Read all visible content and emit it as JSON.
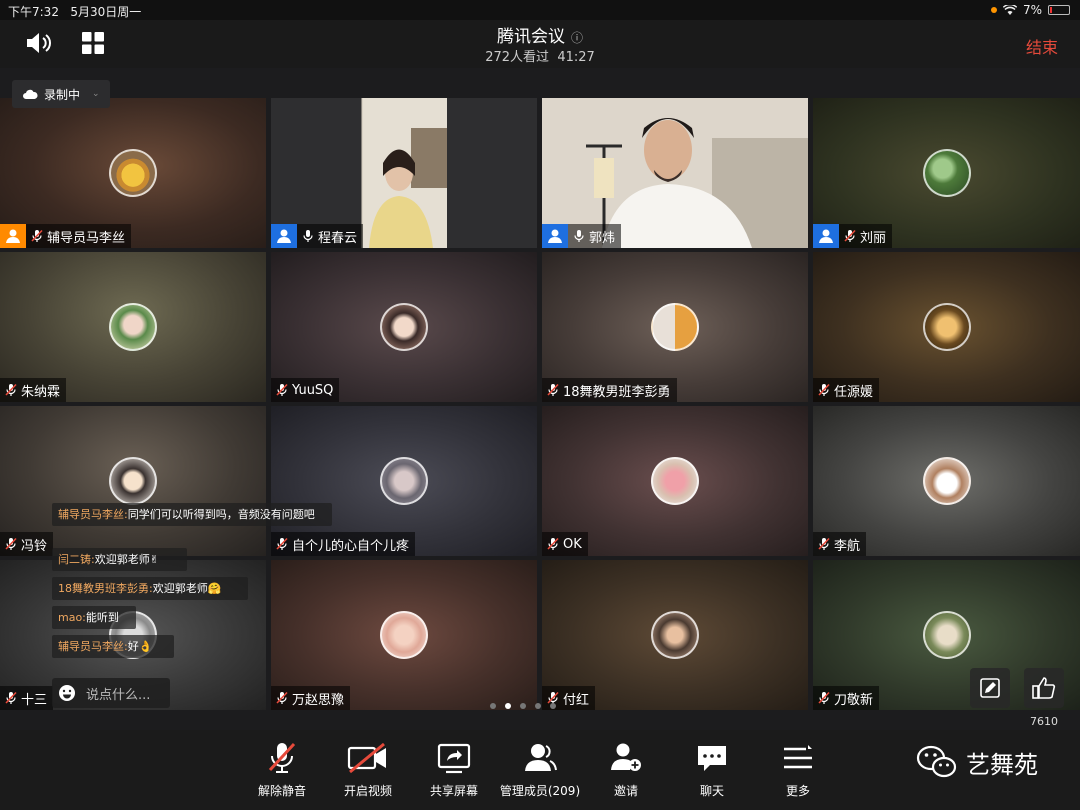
{
  "status_bar": {
    "time": "下午7:32",
    "date": "5月30日周一",
    "battery": "7%"
  },
  "header": {
    "title": "腾讯会议",
    "info_icon": "info-icon",
    "viewers": "272人看过",
    "duration": "41:27",
    "end_label": "结束"
  },
  "recording": {
    "label": "录制中"
  },
  "participants": [
    {
      "name": "辅导员马李丝",
      "host": true,
      "host_color": "#ff8a00"
    },
    {
      "name": "程春云",
      "host": true,
      "host_color": "#1e6fe0",
      "video": true
    },
    {
      "name": "郭炜",
      "host": true,
      "host_color": "#1e6fe0",
      "video": true,
      "speaking": true
    },
    {
      "name": "刘丽",
      "host": true,
      "host_color": "#1e6fe0"
    },
    {
      "name": "朱纳霖"
    },
    {
      "name": "YuuSQ"
    },
    {
      "name": "18舞教男班李彭勇"
    },
    {
      "name": "任源媛"
    },
    {
      "name": "冯铃"
    },
    {
      "name": "自个儿的心自个儿疼"
    },
    {
      "name": "OK"
    },
    {
      "name": "李航"
    },
    {
      "name": "十三"
    },
    {
      "name": "万赵思豫"
    },
    {
      "name": "付红"
    },
    {
      "name": "刀敬新"
    }
  ],
  "chat": {
    "messages": [
      {
        "sender": "辅导员马李丝:",
        "text": "同学们可以听得到吗，音频没有问题吧"
      },
      {
        "sender": "闫二铸:",
        "text": "欢迎郭老师✌"
      },
      {
        "sender": "18舞教男班李彭勇:",
        "text": "欢迎郭老师🤗"
      },
      {
        "sender": "mao:",
        "text": "能听到"
      },
      {
        "sender": "辅导员马李丝:",
        "text": "好👌"
      }
    ],
    "placeholder": "说点什么..."
  },
  "counter": "7610",
  "toolbar": {
    "unmute": "解除静音",
    "video": "开启视频",
    "share": "共享屏幕",
    "members": "管理成员(209)",
    "invite": "邀请",
    "chat": "聊天",
    "more": "更多"
  },
  "brand": {
    "name": "艺舞苑"
  },
  "colors": {
    "accent_end": "#e64a3b",
    "speaking_border": "#2db84d",
    "host_blue": "#1e6fe0",
    "host_orange": "#ff8a00"
  }
}
